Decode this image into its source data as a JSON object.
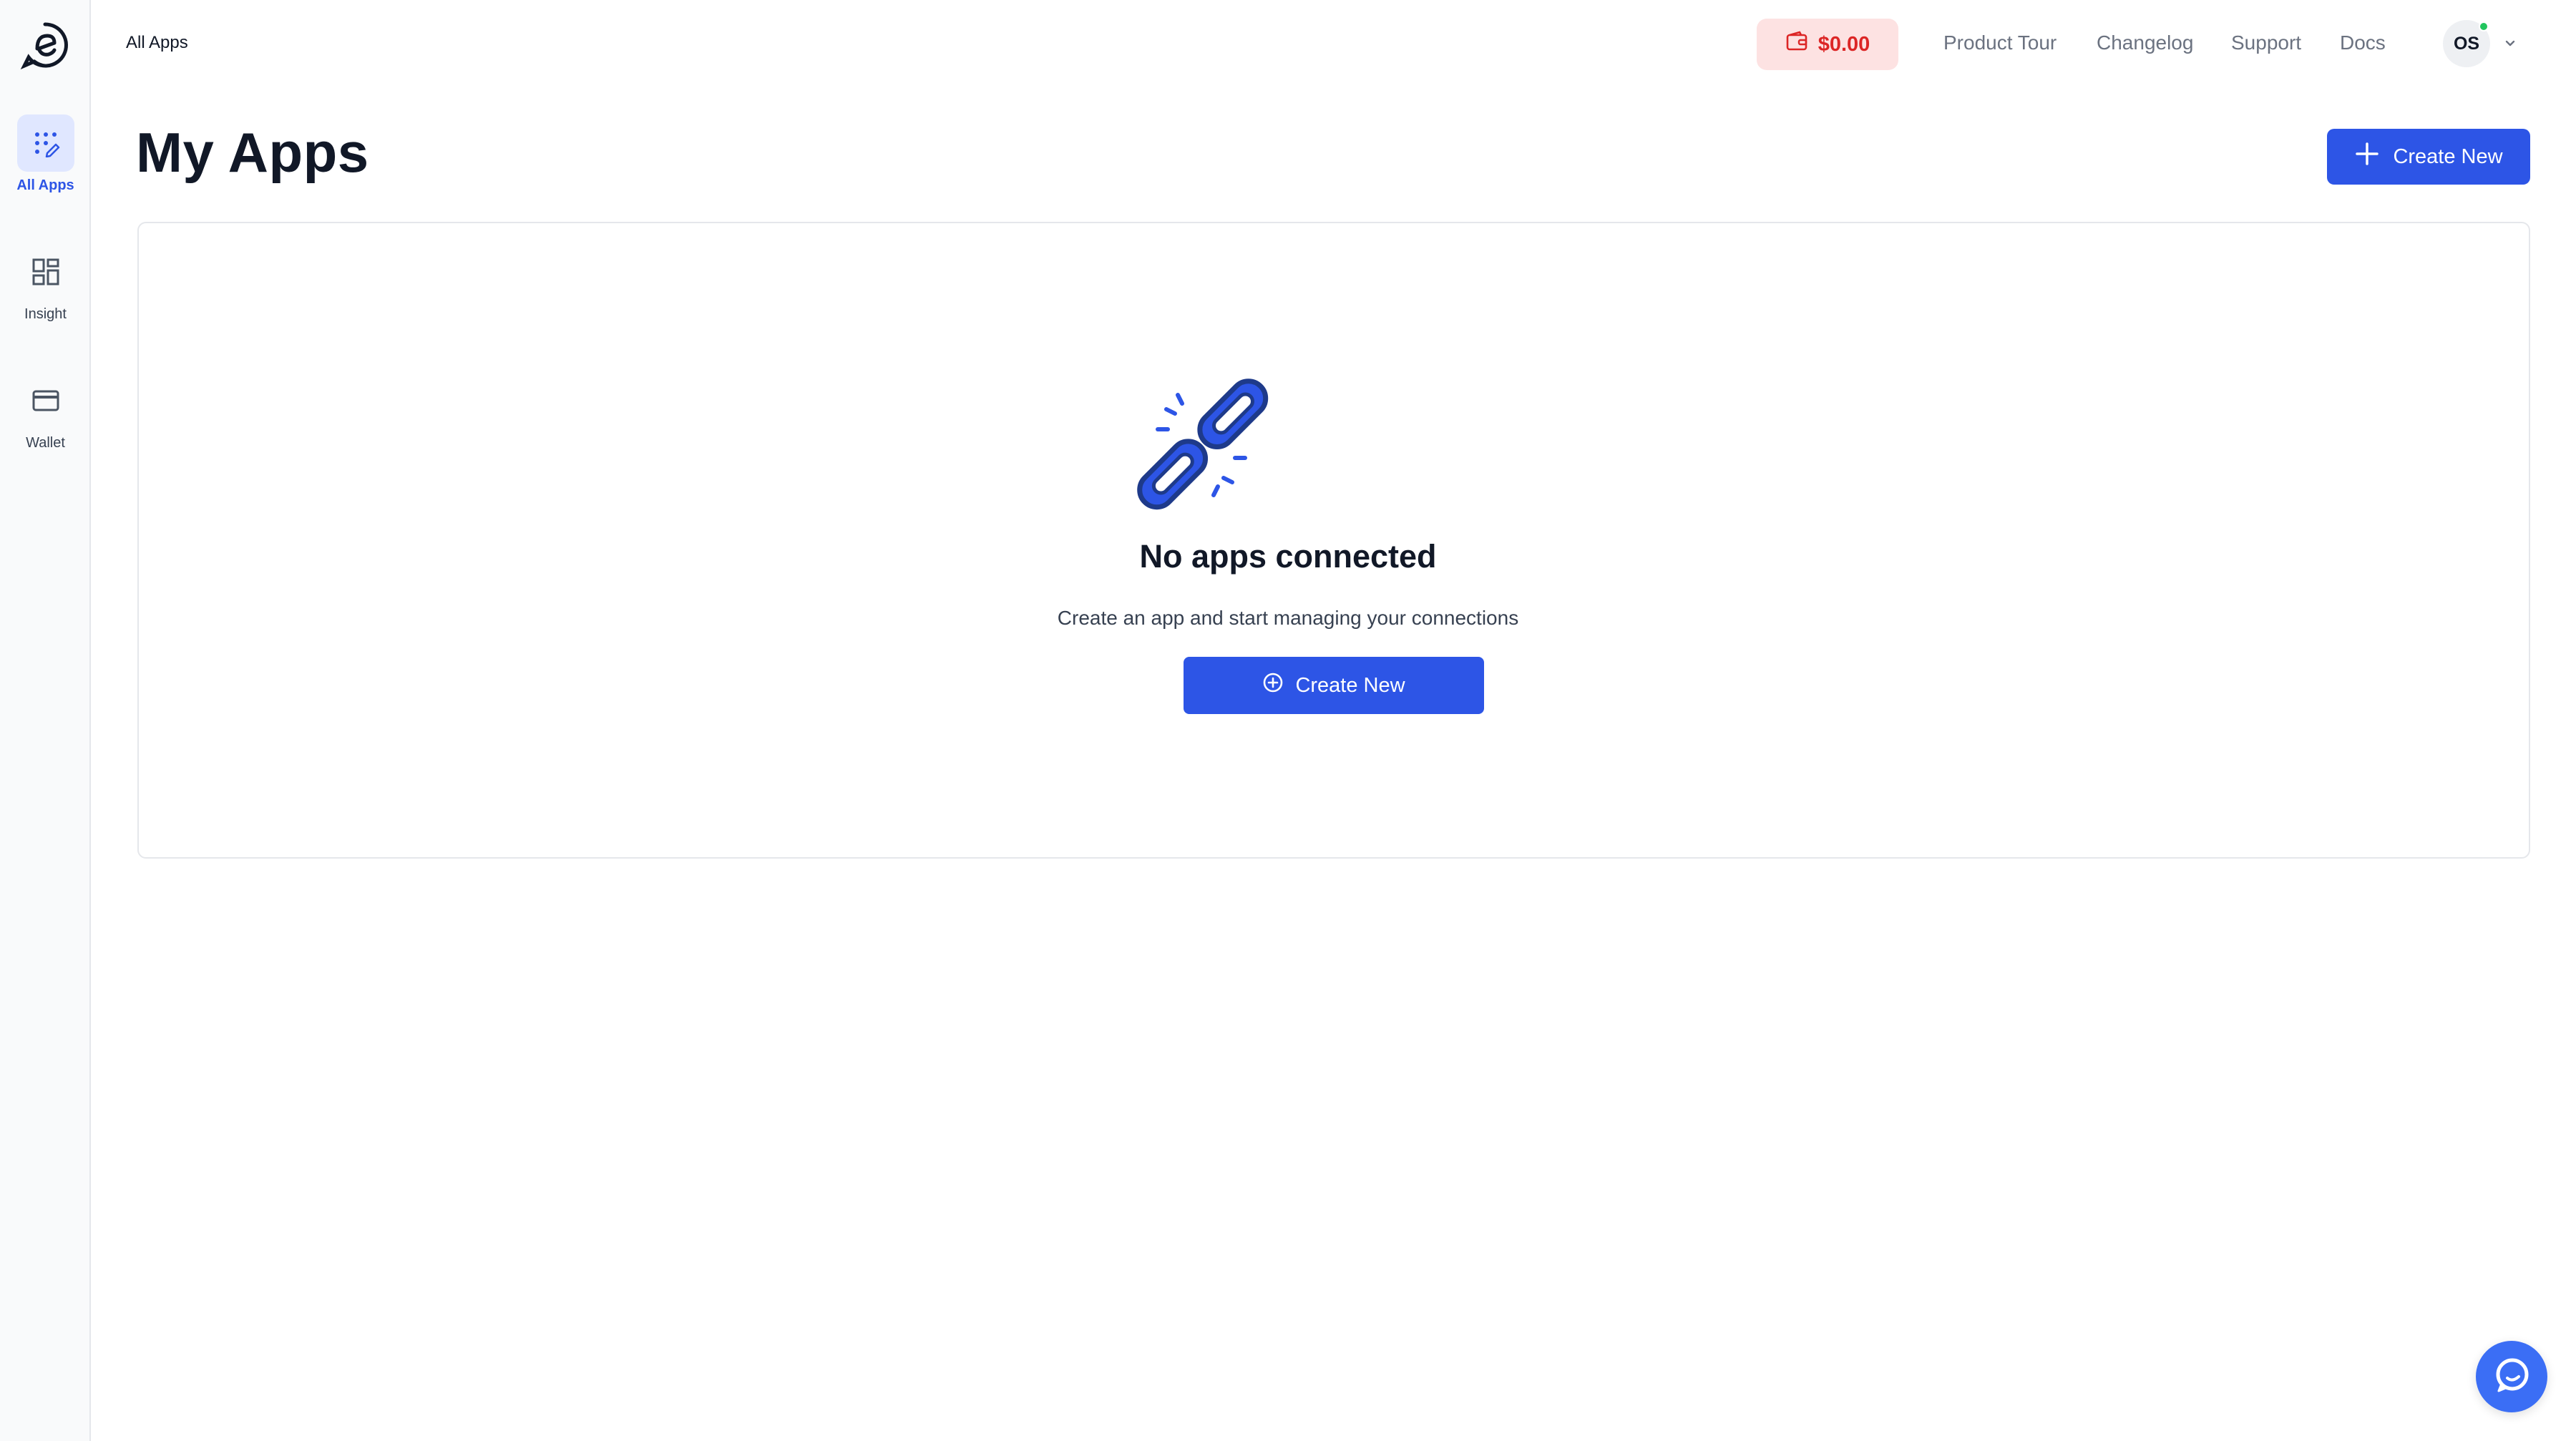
{
  "topbar": {
    "breadcrumb": "All Apps",
    "wallet_balance": "$0.00",
    "links": [
      "Product Tour",
      "Changelog",
      "Support",
      "Docs"
    ],
    "user_initials": "OS"
  },
  "sidebar": {
    "items": [
      {
        "label": "All Apps",
        "icon": "apps-grid-icon",
        "active": true
      },
      {
        "label": "Insight",
        "icon": "dashboard-icon",
        "active": false
      },
      {
        "label": "Wallet",
        "icon": "credit-card-icon",
        "active": false
      }
    ]
  },
  "header": {
    "title": "My Apps",
    "create_label": "Create New"
  },
  "empty_state": {
    "title": "No apps connected",
    "subtitle": "Create an app and start managing your connections",
    "button_label": "Create New",
    "icon": "broken-link-icon"
  },
  "colors": {
    "primary": "#2d55e6",
    "wallet_bg": "#fde2e2",
    "wallet_text": "#dc2626",
    "online": "#22c55e"
  }
}
